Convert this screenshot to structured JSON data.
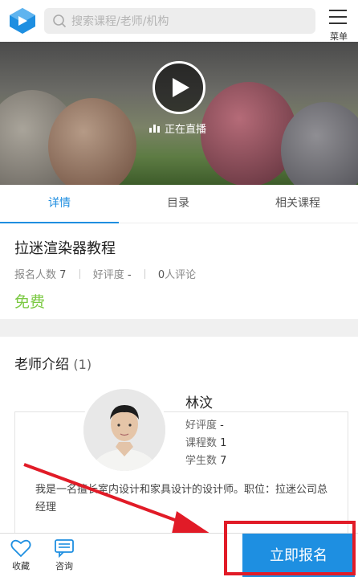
{
  "header": {
    "search_placeholder": "搜索课程/老师/机构",
    "menu_label": "菜单"
  },
  "hero": {
    "live_label": "正在直播"
  },
  "tabs": [
    {
      "label": "详情",
      "active": true
    },
    {
      "label": "目录",
      "active": false
    },
    {
      "label": "相关课程",
      "active": false
    }
  ],
  "course": {
    "title": "拉迷渲染器教程",
    "enroll_label": "报名人数",
    "enroll_count": "7",
    "rating_label": "好评度",
    "rating_value": "-",
    "reviews_count": "0",
    "reviews_label": "人评论",
    "price": "免费"
  },
  "teacher_section": {
    "title": "老师介绍",
    "count": "(1)",
    "teacher": {
      "name": "林汶",
      "rating_label": "好评度",
      "rating_value": "-",
      "courses_label": "课程数",
      "courses_value": "1",
      "students_label": "学生数",
      "students_value": "7",
      "bio": "我是一名擅长室内设计和家具设计的设计师。职位：拉迷公司总经理"
    }
  },
  "bottom_bar": {
    "favorite_label": "收藏",
    "consult_label": "咨询",
    "signup_label": "立即报名"
  },
  "colors": {
    "accent": "#1e8fe1",
    "price_green": "#7bc943",
    "annotation_red": "#e11b27"
  }
}
